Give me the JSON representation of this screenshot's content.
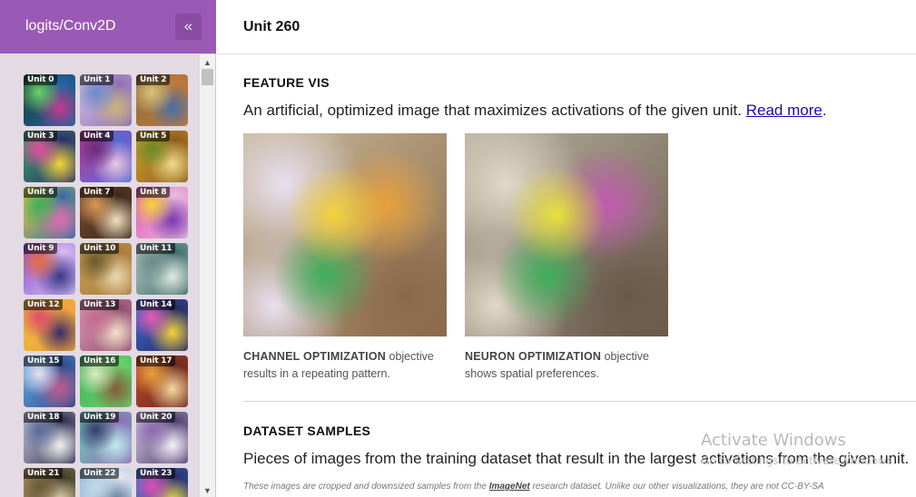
{
  "sidebar": {
    "title": "logits/Conv2D",
    "collapse_icon": "«",
    "units": [
      {
        "label": "Unit 0",
        "colors": [
          "#1b3a2a",
          "#6bd36b",
          "#c23b8f",
          "#2266aa"
        ]
      },
      {
        "label": "Unit 1",
        "colors": [
          "#d8c9e8",
          "#6a88c8",
          "#c9b27a",
          "#8c6bb1"
        ]
      },
      {
        "label": "Unit 2",
        "colors": [
          "#8a6b3e",
          "#d9c37a",
          "#4a6fa8",
          "#c27b3b"
        ]
      },
      {
        "label": "Unit 3",
        "colors": [
          "#3da86b",
          "#e84aa0",
          "#f3d23b",
          "#2c2c6a"
        ]
      },
      {
        "label": "Unit 4",
        "colors": [
          "#c03b9b",
          "#6b2c7a",
          "#e8c7e0",
          "#4f6bd8"
        ]
      },
      {
        "label": "Unit 5",
        "colors": [
          "#d8a62b",
          "#6b8a2c",
          "#f0d98a",
          "#8a5a1e"
        ]
      },
      {
        "label": "Unit 6",
        "colors": [
          "#f0d23b",
          "#3cae5a",
          "#e06bb0",
          "#2c6aa8"
        ]
      },
      {
        "label": "Unit 7",
        "colors": [
          "#7a4a2a",
          "#d89a5a",
          "#f3e0c0",
          "#3a2a1e"
        ]
      },
      {
        "label": "Unit 8",
        "colors": [
          "#e04ab0",
          "#f3d23b",
          "#7a3ab0",
          "#e8c0e0"
        ]
      },
      {
        "label": "Unit 9",
        "colors": [
          "#8a4bd8",
          "#e86b3b",
          "#3b3b8a",
          "#d8c0f0"
        ]
      },
      {
        "label": "Unit 10",
        "colors": [
          "#c9a25a",
          "#6b5a2c",
          "#e8d9b0",
          "#a87a3b"
        ]
      },
      {
        "label": "Unit 11",
        "colors": [
          "#b8d0c8",
          "#6a8a8a",
          "#e0e8e0",
          "#3b6a6a"
        ]
      },
      {
        "label": "Unit 12",
        "colors": [
          "#e8c03b",
          "#e04a6b",
          "#3b2a6a",
          "#f0a03b"
        ]
      },
      {
        "label": "Unit 13",
        "colors": [
          "#e8a0c0",
          "#c06b8a",
          "#f3e0c8",
          "#8a4a6b"
        ]
      },
      {
        "label": "Unit 14",
        "colors": [
          "#3b6ad8",
          "#e85ab0",
          "#f3d23b",
          "#2a2a5a"
        ]
      },
      {
        "label": "Unit 15",
        "colors": [
          "#6ab0e8",
          "#e8e0f0",
          "#c05a8a",
          "#2a4a8a"
        ]
      },
      {
        "label": "Unit 16",
        "colors": [
          "#3cae5a",
          "#e0e8c0",
          "#8a5a3b",
          "#6bd36b"
        ]
      },
      {
        "label": "Unit 17",
        "colors": [
          "#c04a2a",
          "#e8a03b",
          "#f3d9a0",
          "#6a2a1e"
        ]
      },
      {
        "label": "Unit 18",
        "colors": [
          "#d8d8e8",
          "#5a6a9a",
          "#f0f0f0",
          "#2a2a4a"
        ]
      },
      {
        "label": "Unit 19",
        "colors": [
          "#6ad8c0",
          "#3a3a6a",
          "#c0e8f0",
          "#8a6ab0"
        ]
      },
      {
        "label": "Unit 20",
        "colors": [
          "#e0d0e8",
          "#8a6ab0",
          "#f3f0f8",
          "#4a3a6a"
        ]
      },
      {
        "label": "Unit 21",
        "colors": [
          "#c0a06b",
          "#6a5a3a",
          "#e8d8b0",
          "#3a3a2a"
        ]
      },
      {
        "label": "Unit 22",
        "colors": [
          "#8ab0d8",
          "#c0d8e8",
          "#5a7a9a",
          "#e8e8f0"
        ]
      },
      {
        "label": "Unit 23",
        "colors": [
          "#3b8ad8",
          "#e04ab0",
          "#f3e03b",
          "#2a2a6a"
        ]
      }
    ]
  },
  "header": {
    "unit_title": "Unit 260"
  },
  "feature_vis": {
    "title": "FEATURE VIS",
    "description": "An artificial, optimized image that maximizes activations of the given unit.",
    "read_more": "Read more",
    "period": ".",
    "channel": {
      "bold": "CHANNEL OPTIMIZATION",
      "text_line1": " objective",
      "text_line2": "results in a repeating pattern.",
      "colors": [
        "#c8b89a",
        "#f3d23b",
        "#3cae5a",
        "#e8a03b",
        "#8a6a4a",
        "#e8e0f0"
      ]
    },
    "neuron": {
      "bold": "NEURON OPTIMIZATION",
      "text_line1": " objective",
      "text_line2": "shows spatial preferences.",
      "colors": [
        "#b8b0a0",
        "#e8e03b",
        "#3cae5a",
        "#c05ab0",
        "#6a5a4a",
        "#e0d8c8"
      ]
    }
  },
  "dataset_samples": {
    "title": "DATASET SAMPLES",
    "description": "Pieces of images from the training dataset that result in the largest activations from the given unit.",
    "note_prefix": "These images are cropped and downsized samples from the ",
    "note_link": "ImageNet",
    "note_suffix": " research dataset. Unlike our other visualizations, they are not CC-BY-SA"
  },
  "watermark": {
    "title": "Activate Windows",
    "subtitle": "Go to Settings to activate Windows."
  }
}
